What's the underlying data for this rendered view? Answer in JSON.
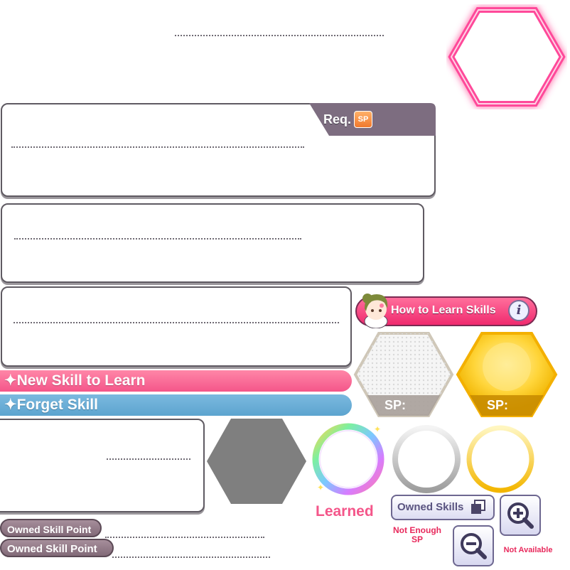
{
  "req_panel": {
    "req_label": "Req.",
    "sp_badge": "SP"
  },
  "howto": {
    "label": "How to Learn Skills",
    "icon": "info-icon"
  },
  "banners": {
    "new_skill": "✦New Skill to Learn",
    "forget_skill": "✦Forget Skill"
  },
  "sp_tiles": {
    "silver_label": "SP:",
    "gold_label": "SP:"
  },
  "learned_label": "Learned",
  "owned_skills_button": "Owned Skills",
  "not_enough_sp": "Not Enough SP",
  "not_available": "Not Available",
  "owned_skill_point_pills": [
    "Owned Skill Point",
    "Owned Skill Point"
  ],
  "colors": {
    "pink": "#f4568a",
    "blue": "#5ca4cf",
    "gold": "#f3c21a",
    "neon": "#ff4a9a"
  }
}
